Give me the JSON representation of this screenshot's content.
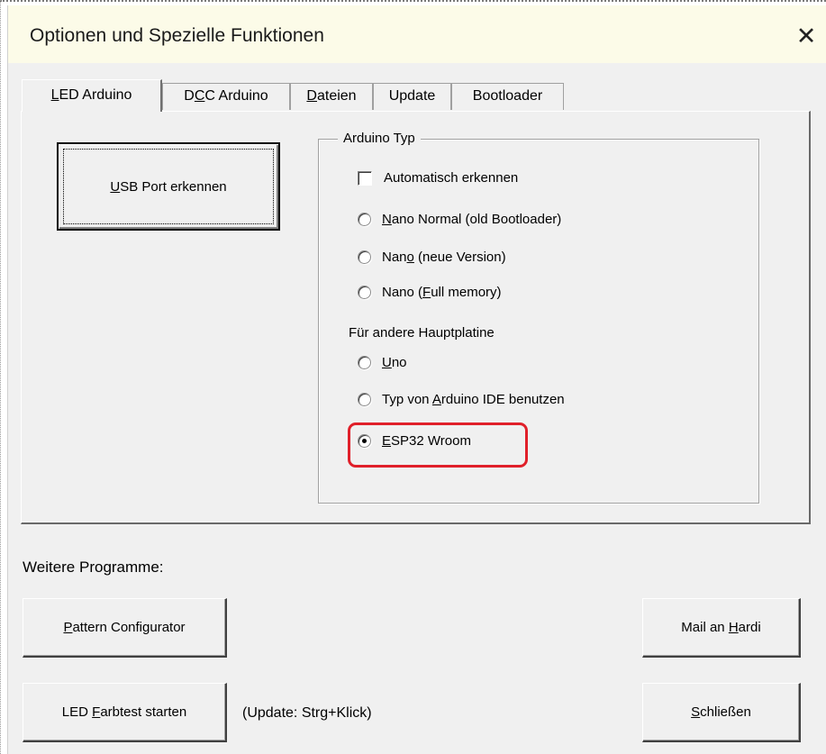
{
  "window": {
    "title": "Optionen und Spezielle Funktionen",
    "close_glyph": "✕"
  },
  "tabs": [
    {
      "pre": "",
      "key": "L",
      "post": "ED Arduino",
      "active": true
    },
    {
      "pre": "D",
      "key": "C",
      "post": "C Arduino",
      "active": false
    },
    {
      "pre": "",
      "key": "D",
      "post": "ateien",
      "active": false
    },
    {
      "pre": "Update",
      "key": "",
      "post": "",
      "active": false
    },
    {
      "pre": "Bootloader",
      "key": "",
      "post": "",
      "active": false
    }
  ],
  "usb_button": {
    "pre": "",
    "key": "U",
    "post": "SB Port erkennen"
  },
  "arduino_type": {
    "legend": "Arduino Typ",
    "auto_detect": {
      "label": "Automatisch erkennen",
      "checked": false
    },
    "options": [
      {
        "pre": "",
        "key": "N",
        "post": "ano Normal (old Bootloader)",
        "checked": false
      },
      {
        "pre": "Nan",
        "key": "o",
        "post": " (neue Version)",
        "checked": false
      },
      {
        "pre": "Nano (",
        "key": "F",
        "post": "ull memory)",
        "checked": false
      }
    ],
    "other_board_label": "Für andere Hauptplatine",
    "other_options": [
      {
        "pre": "",
        "key": "U",
        "post": "no",
        "checked": false
      },
      {
        "pre": "Typ von ",
        "key": "A",
        "post": "rduino IDE benutzen",
        "checked": false
      },
      {
        "pre": "",
        "key": "E",
        "post": "SP32 Wroom",
        "checked": true
      }
    ]
  },
  "more_programs_label": "Weitere Programme:",
  "buttons": {
    "pattern": {
      "pre": "",
      "key": "P",
      "post": "attern Configurator"
    },
    "mail": {
      "pre": "Mail an ",
      "key": "H",
      "post": "ardi"
    },
    "led_test": {
      "pre": "LED ",
      "key": "F",
      "post": "arbtest starten"
    },
    "close": {
      "pre": "",
      "key": "S",
      "post": "chließen"
    }
  },
  "update_hint": "(Update: Strg+Klick)",
  "colors": {
    "highlight": "#e0202a",
    "titlebar": "#fcfbe8",
    "dialog": "#f0f0f0"
  }
}
